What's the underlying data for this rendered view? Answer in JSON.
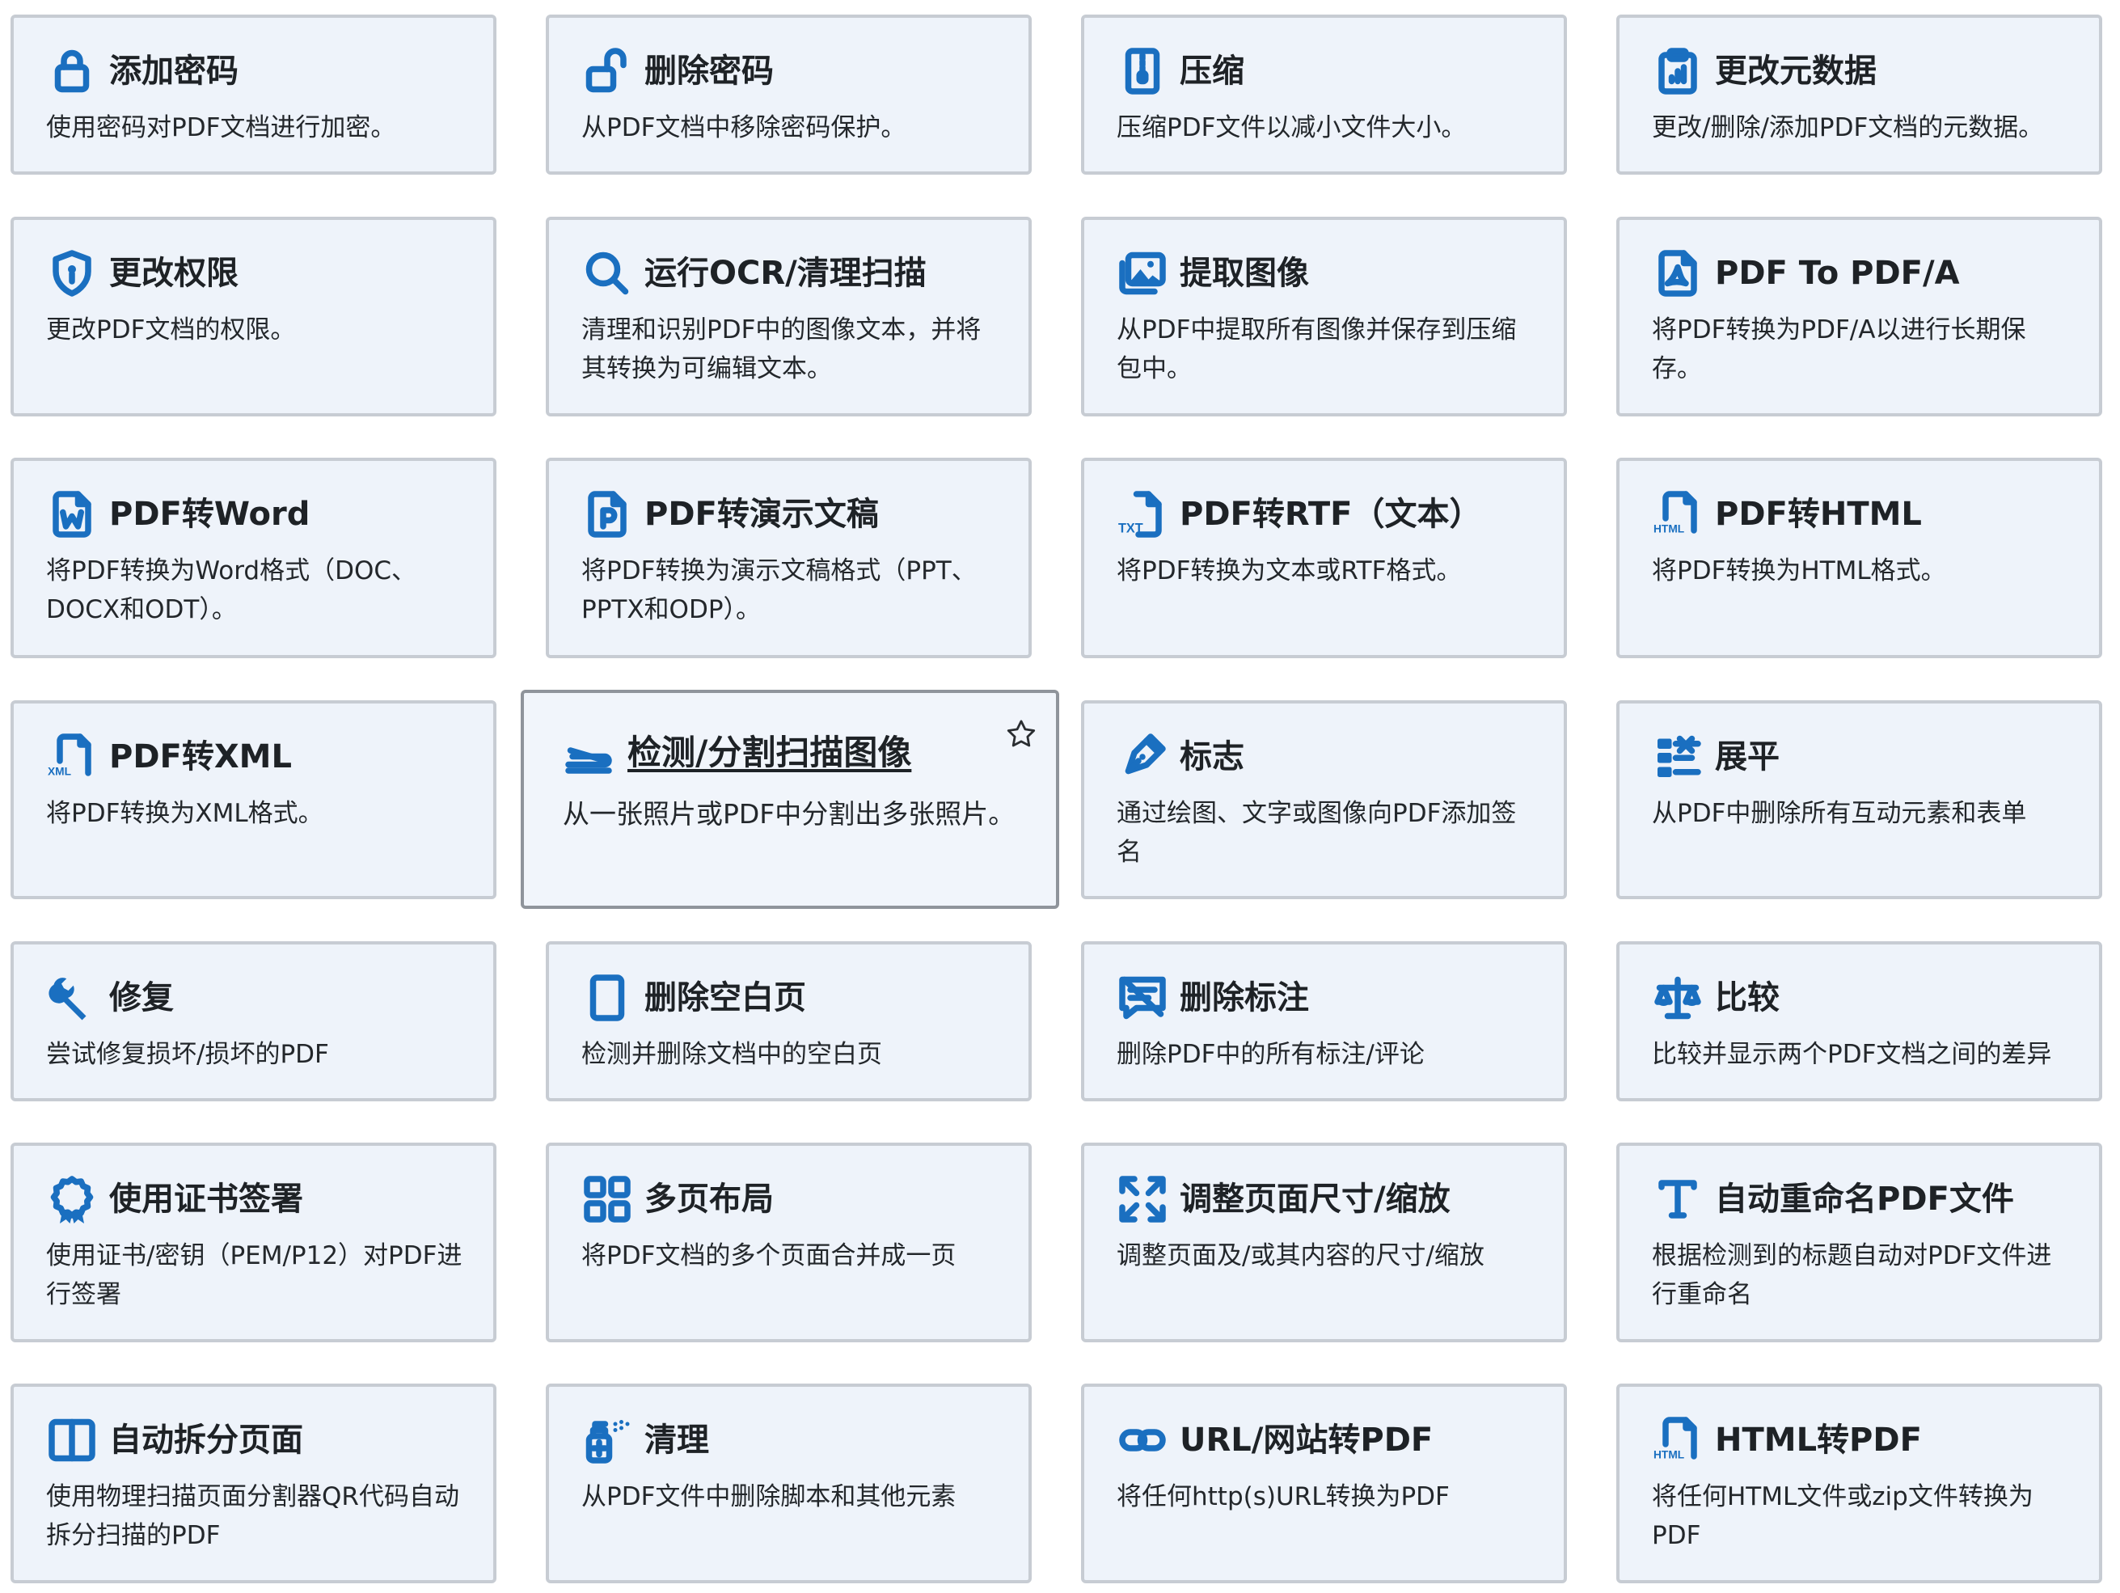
{
  "tools": [
    {
      "title": "添加密码",
      "desc": "使用密码对PDF文档进行加密。",
      "icon": "lock-icon"
    },
    {
      "title": "删除密码",
      "desc": "从PDF文档中移除密码保护。",
      "icon": "unlock-icon"
    },
    {
      "title": "压缩",
      "desc": "压缩PDF文件以减小文件大小。",
      "icon": "zip-file-icon"
    },
    {
      "title": "更改元数据",
      "desc": "更改/删除/添加PDF文档的元数据。",
      "icon": "clipboard-data-icon"
    },
    {
      "title": "更改权限",
      "desc": "更改PDF文档的权限。",
      "icon": "shield-lock-icon"
    },
    {
      "title": "运行OCR/清理扫描",
      "desc": "清理和识别PDF中的图像文本，并将其转换为可编辑文本。",
      "icon": "search-icon"
    },
    {
      "title": "提取图像",
      "desc": "从PDF中提取所有图像并保存到压缩包中。",
      "icon": "images-icon"
    },
    {
      "title": "PDF To PDF/A",
      "desc": "将PDF转换为PDF/A以进行长期保存。",
      "icon": "pdf-file-icon"
    },
    {
      "title": "PDF转Word",
      "desc": "将PDF转换为Word格式（DOC、DOCX和ODT）。",
      "icon": "word-file-icon"
    },
    {
      "title": "PDF转演示文稿",
      "desc": "将PDF转换为演示文稿格式（PPT、PPTX和ODP）。",
      "icon": "ppt-file-icon"
    },
    {
      "title": "PDF转RTF（文本）",
      "desc": "将PDF转换为文本或RTF格式。",
      "icon": "txt-file-icon"
    },
    {
      "title": "PDF转HTML",
      "desc": "将PDF转换为HTML格式。",
      "icon": "html-file-icon"
    },
    {
      "title": "PDF转XML",
      "desc": "将PDF转换为XML格式。",
      "icon": "xml-file-icon"
    },
    {
      "title": "检测/分割扫描图像",
      "desc": "从一张照片或PDF中分割出多张照片。",
      "icon": "scanner-icon"
    },
    {
      "title": "标志",
      "desc": "通过绘图、文字或图像向PDF添加签名",
      "icon": "pen-nib-icon"
    },
    {
      "title": "展平",
      "desc": "从PDF中删除所有互动元素和表单",
      "icon": "checklist-icon"
    },
    {
      "title": "修复",
      "desc": "尝试修复损坏/损坏的PDF",
      "icon": "wrench-icon"
    },
    {
      "title": "删除空白页",
      "desc": "检测并删除文档中的空白页",
      "icon": "blank-page-icon"
    },
    {
      "title": "删除标注",
      "desc": "删除PDF中的所有标注/评论",
      "icon": "comment-remove-icon"
    },
    {
      "title": "比较",
      "desc": "比较并显示两个PDF文档之间的差异",
      "icon": "scale-icon"
    },
    {
      "title": "使用证书签署",
      "desc": "使用证书/密钥（PEM/P12）对PDF进行签署",
      "icon": "award-icon"
    },
    {
      "title": "多页布局",
      "desc": "将PDF文档的多个页面合并成一页",
      "icon": "grid-icon"
    },
    {
      "title": "调整页面尺寸/缩放",
      "desc": "调整页面及/或其内容的尺寸/缩放",
      "icon": "expand-icon"
    },
    {
      "title": "自动重命名PDF文件",
      "desc": "根据检测到的标题自动对PDF文件进行重命名",
      "icon": "type-icon"
    },
    {
      "title": "自动拆分页面",
      "desc": "使用物理扫描页面分割器QR代码自动拆分扫描的PDF",
      "icon": "split-icon"
    },
    {
      "title": "清理",
      "desc": "从PDF文件中删除脚本和其他元素",
      "icon": "spray-icon"
    },
    {
      "title": "URL/网站转PDF",
      "desc": "将任何http(s)URL转换为PDF",
      "icon": "link-icon"
    },
    {
      "title": "HTML转PDF",
      "desc": "将任何HTML文件或zip文件转换为PDF",
      "icon": "html-file-icon"
    }
  ],
  "colors": {
    "accent": "#1a6fc0",
    "card_bg": "#eef3fa",
    "card_border": "#c7ccd3",
    "text": "#1e2226"
  },
  "favorite_icon": "star-icon"
}
